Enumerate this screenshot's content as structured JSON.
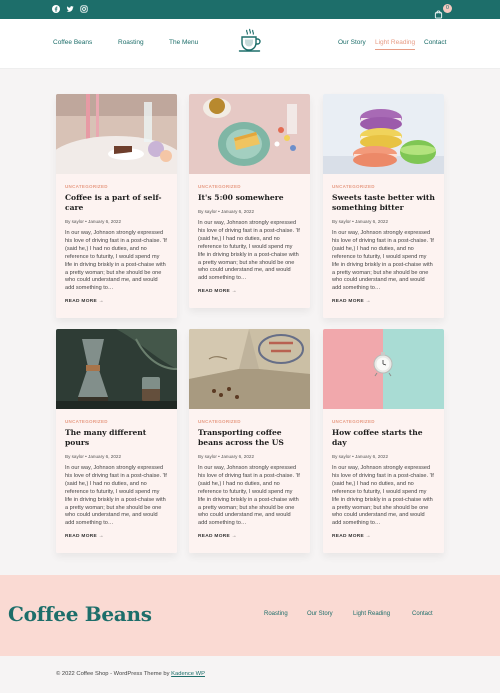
{
  "topbar": {
    "social_icons": [
      "facebook-icon",
      "twitter-icon",
      "instagram-icon"
    ],
    "cart_count": "0",
    "accent_color": "#1d6e6a"
  },
  "header": {
    "nav_left": [
      "Coffee Beans",
      "Roasting",
      "The Menu"
    ],
    "nav_right": [
      "Our Story",
      "Light Reading",
      "Contact"
    ],
    "active": "Light Reading"
  },
  "posts": [
    {
      "category": "UNCATEGORIZED",
      "title": "Coffee is a part of self-care",
      "meta": "By saylor  •  January 6, 2022",
      "excerpt": "In our way, Johnson strongly expressed his love of driving fast in a post-chaise. 'If (said he,) I had no duties, and no reference to futurity, I would spend my life in driving briskly in a post-chaise with a pretty woman; but she should be one who could understand me, and would add something to…",
      "more": "READ MORE →"
    },
    {
      "category": "UNCATEGORIZED",
      "title": "It's 5:00 somewhere",
      "meta": "By saylor  •  January 6, 2022",
      "excerpt": "In our way, Johnson strongly expressed his love of driving fast in a post-chaise. 'If (said he,) I had no duties, and no reference to futurity, I would spend my life in driving briskly in a post-chaise with a pretty woman; but she should be one who could understand me, and would add something to…",
      "more": "READ MORE →"
    },
    {
      "category": "UNCATEGORIZED",
      "title": "Sweets taste better with something bitter",
      "meta": "By saylor  •  January 6, 2022",
      "excerpt": "In our way, Johnson strongly expressed his love of driving fast in a post-chaise. 'If (said he,) I had no duties, and no reference to futurity, I would spend my life in driving briskly in a post-chaise with a pretty woman; but she should be one who could understand me, and would add something to…",
      "more": "READ MORE →"
    },
    {
      "category": "UNCATEGORIZED",
      "title": "The many different pours",
      "meta": "By saylor  •  January 6, 2022",
      "excerpt": "In our way, Johnson strongly expressed his love of driving fast in a post-chaise. 'If (said he,) I had no duties, and no reference to futurity, I would spend my life in driving briskly in a post-chaise with a pretty woman; but she should be one who could understand me, and would add something to…",
      "more": "READ MORE →"
    },
    {
      "category": "UNCATEGORIZED",
      "title": "Transporting coffee beans across the US",
      "meta": "By saylor  •  January 6, 2022",
      "excerpt": "In our way, Johnson strongly expressed his love of driving fast in a post-chaise. 'If (said he,) I had no duties, and no reference to futurity, I would spend my life in driving briskly in a post-chaise with a pretty woman; but she should be one who could understand me, and would add something to…",
      "more": "READ MORE →"
    },
    {
      "category": "UNCATEGORIZED",
      "title": "How coffee starts the day",
      "meta": "By saylor  •  January 6, 2022",
      "excerpt": "In our way, Johnson strongly expressed his love of driving fast in a post-chaise. 'If (said he,) I had no duties, and no reference to futurity, I would spend my life in driving briskly in a post-chaise with a pretty woman; but she should be one who could understand me, and would add something to…",
      "more": "READ MORE →"
    }
  ],
  "footer": {
    "brand": "Coffee Beans",
    "links": [
      "Roasting",
      "Our Story",
      "Light Reading",
      "Contact"
    ],
    "copyright_prefix": "© 2022 Coffee Shop - WordPress Theme by ",
    "copyright_link": "Kadence WP",
    "background": "#fadad3"
  }
}
